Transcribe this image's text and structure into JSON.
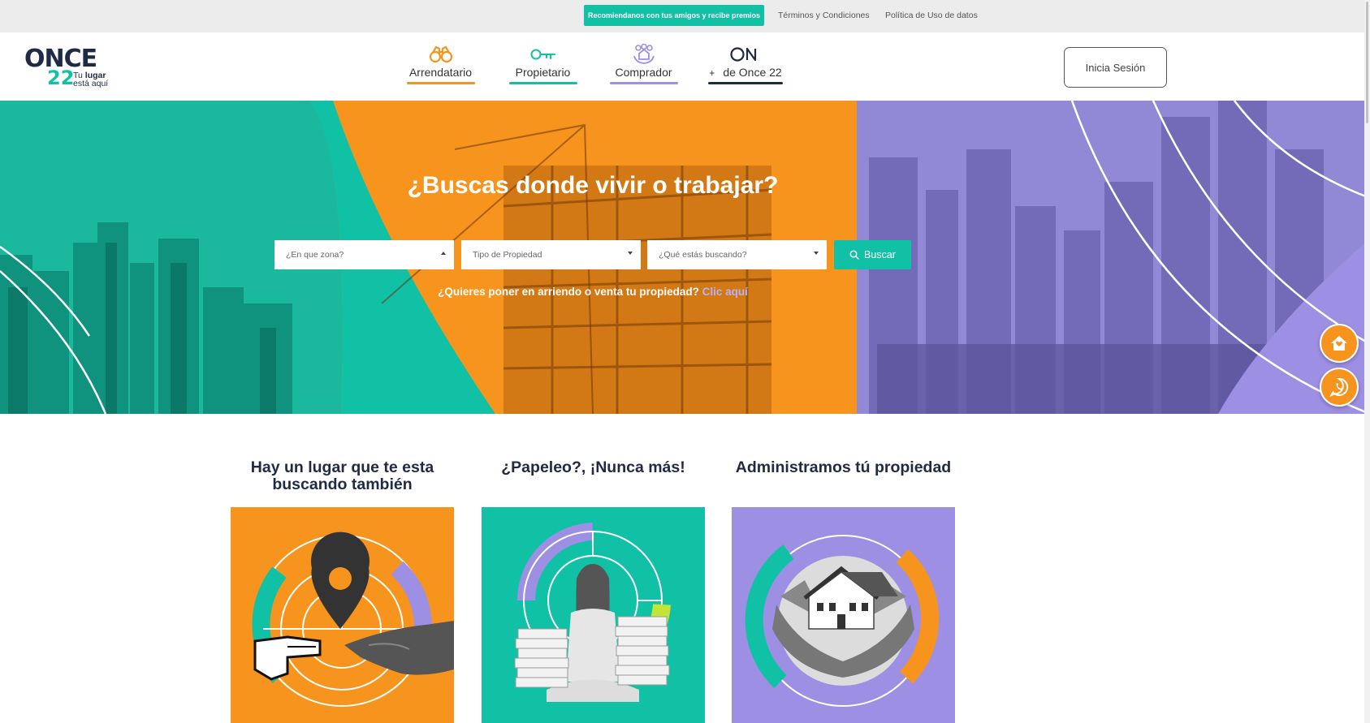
{
  "topbar": {
    "refer_button": "Recomiendanos con tus amigos y recibe premios",
    "links": [
      "Términos y Condiciones",
      "Política de Uso de datos"
    ]
  },
  "logo": {
    "word": "ONCE",
    "number": "22",
    "tagline_prefix": "Tu ",
    "tagline_bold": "lugar",
    "tagline_line2": "está aquí"
  },
  "nav": [
    {
      "label": "Arrendatario",
      "icon": "binoculars-icon",
      "color": "#f7941d"
    },
    {
      "label": "Propietario",
      "icon": "key-icon",
      "color": "#11c1a6"
    },
    {
      "label": "Comprador",
      "icon": "house-hands-icon",
      "color": "#9d8fe3"
    },
    {
      "label": "de Once 22",
      "prefix": "+",
      "icon": "on-logo-icon",
      "color": "#1f2a44"
    }
  ],
  "header": {
    "login_label": "Inicia Sesión"
  },
  "hero": {
    "title": "¿Buscas donde vivir o trabajar?",
    "selects": [
      {
        "placeholder": "¿En que zona?",
        "caret": "up"
      },
      {
        "placeholder": "Tipo de Propiedad",
        "caret": "down"
      },
      {
        "placeholder": "¿Qué estás buscando?",
        "caret": "down"
      }
    ],
    "search_label": "Buscar",
    "cta_text": "¿Quieres poner en arriendo o venta tu propiedad? ",
    "cta_link": "Clic aquí"
  },
  "floating": {
    "home_icon": "home-icon",
    "whatsapp_icon": "whatsapp-icon"
  },
  "features": [
    {
      "title": "Hay un lugar que te esta buscando también",
      "color": "#f7941d"
    },
    {
      "title": "¿Papeleo?, ¡Nunca más!",
      "color": "#11c1a6"
    },
    {
      "title": "Administramos tú propiedad",
      "color": "#9d8fe3"
    }
  ],
  "colors": {
    "teal": "#11c1a6",
    "orange": "#f7941d",
    "purple": "#9d8fe3",
    "navy": "#1f2a44"
  }
}
